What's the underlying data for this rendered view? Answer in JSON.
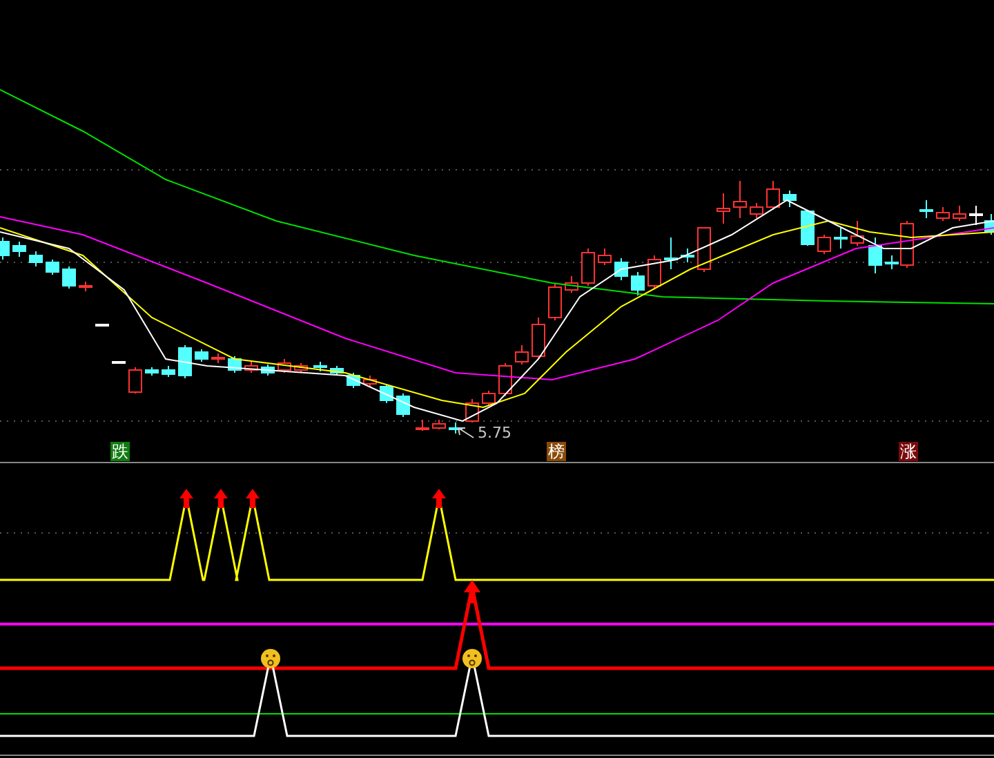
{
  "signals": [
    {
      "label": "跌",
      "color": "#107c10"
    },
    {
      "label": "榜",
      "color": "#8a4a08"
    },
    {
      "label": "涨",
      "color": "#7a0a0a"
    }
  ],
  "low_marker": {
    "value": "5.75"
  }
}
